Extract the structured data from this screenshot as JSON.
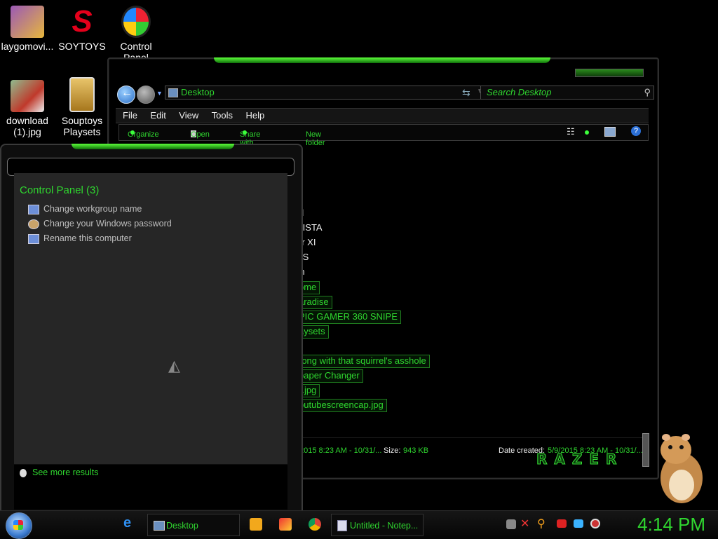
{
  "desktop_icons": [
    {
      "label": "laygomovi...",
      "icon": "movie-file-icon"
    },
    {
      "label": "SOYTOYS",
      "icon": "soytoys-logo-icon"
    },
    {
      "label": "Control Panel",
      "icon": "control-panel-icon"
    },
    {
      "label": "download (1).jpg",
      "icon": "image-file-icon"
    },
    {
      "label": "Souptoys Playsets",
      "icon": "souptoys-icon"
    }
  ],
  "explorer": {
    "address": "Desktop",
    "search_placeholder": "Search Desktop",
    "menu": [
      "File",
      "Edit",
      "View",
      "Tools",
      "Help"
    ],
    "commands": {
      "organize": "Organize",
      "open": "Open",
      "share": "Share with",
      "new_folder": "New folder"
    },
    "files": [
      {
        "text": "p",
        "highlight": false
      },
      {
        "text": "el",
        "highlight": false
      },
      {
        "text": "VISTA",
        "highlight": false
      },
      {
        "text": "er XI",
        "highlight": false
      },
      {
        "text": "KS",
        "highlight": false
      },
      {
        "text": "rn",
        "highlight": false
      },
      {
        "text": "ome",
        "highlight": true
      },
      {
        "text": "aradise",
        "highlight": true
      },
      {
        "text": "PIC GAMER 360 SNIPE",
        "highlight": true
      },
      {
        "text": "aysets",
        "highlight": true
      },
      {
        "text": "rong with that squirrel's asshole",
        "highlight": true
      },
      {
        "text": "paper Changer",
        "highlight": true
      },
      {
        "text": ").jpg",
        "highlight": true
      },
      {
        "text": "outubescreencap.jpg",
        "highlight": true
      }
    ],
    "status": {
      "modified": "2015 8:23 AM - 10/31/...",
      "size_label": "Size:",
      "size": "943 KB",
      "created_label": "Date created:",
      "created": "5/9/2015 8:23 AM - 10/31/...",
      "brand": "RAZER"
    }
  },
  "start_panel": {
    "section_title": "Control Panel (3)",
    "items": [
      "Change workgroup name",
      "Change your Windows password",
      "Rename this computer"
    ],
    "see_more": "See more results"
  },
  "taskbar": {
    "buttons": [
      {
        "label": "Desktop",
        "icon": "folder-icon"
      },
      {
        "label": "Untitled - Notep...",
        "icon": "notepad-icon"
      }
    ],
    "pinned": [
      "internet-explorer-icon",
      "media-player-icon",
      "paint-icon",
      "chrome-icon"
    ],
    "tray_icons": [
      "network-icon",
      "tool-icon",
      "search-icon",
      "flag-icon",
      "display-icon",
      "speaker-icon"
    ],
    "clock": "4:14 PM"
  }
}
